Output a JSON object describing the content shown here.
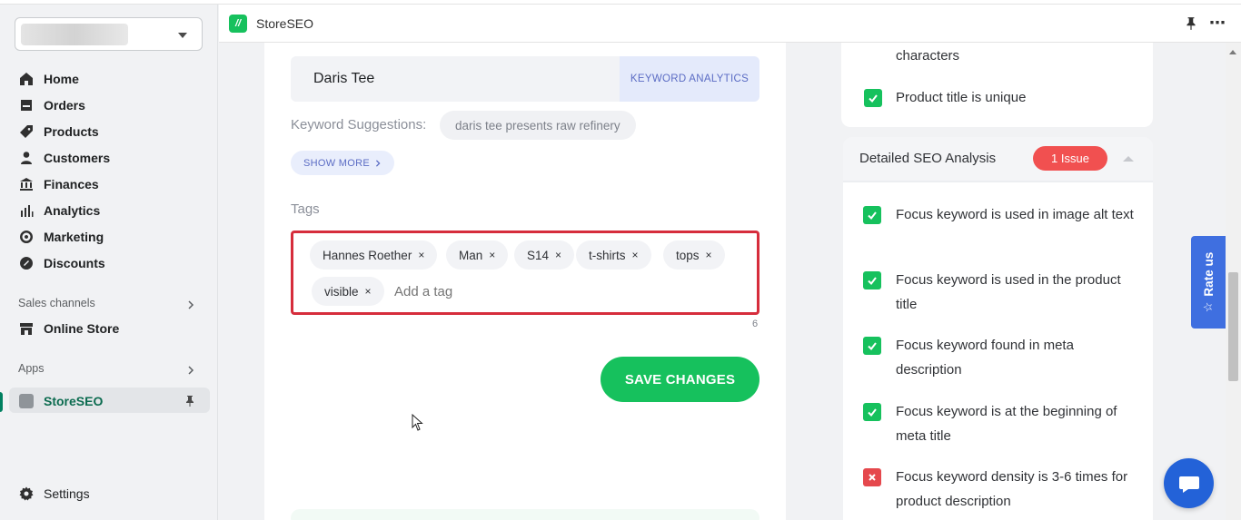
{
  "sidebar": {
    "nav": [
      {
        "label": "Home",
        "icon": "home-icon"
      },
      {
        "label": "Orders",
        "icon": "orders-icon"
      },
      {
        "label": "Products",
        "icon": "tag-icon"
      },
      {
        "label": "Customers",
        "icon": "person-icon"
      },
      {
        "label": "Finances",
        "icon": "bank-icon"
      },
      {
        "label": "Analytics",
        "icon": "bar-chart-icon"
      },
      {
        "label": "Marketing",
        "icon": "target-icon"
      },
      {
        "label": "Discounts",
        "icon": "discount-icon"
      }
    ],
    "sales_channels_label": "Sales channels",
    "online_store_label": "Online Store",
    "apps_label": "Apps",
    "storeseo_label": "StoreSEO",
    "settings_label": "Settings"
  },
  "appbar": {
    "title": "StoreSEO",
    "logo_glyph": "//"
  },
  "editor": {
    "keyword_value": "Daris Tee",
    "keyword_analytics_label": "KEYWORD ANALYTICS",
    "keyword_suggestions_label": "Keyword Suggestions:",
    "suggestion_chip": "daris tee presents raw refinery",
    "show_more_label": "SHOW MORE",
    "tags_label": "Tags",
    "tags": [
      "Hannes Roether",
      "Man",
      "S14",
      "t-shirts",
      "tops",
      "visible"
    ],
    "tag_remove_glyph": "×",
    "tag_placeholder": "Add a tag",
    "tag_count": "6",
    "save_label": "SAVE CHANGES"
  },
  "seo": {
    "top_items": [
      {
        "text": "characters",
        "status": "none"
      },
      {
        "text": "Product title is unique",
        "status": "pass"
      }
    ],
    "detailed_title": "Detailed SEO Analysis",
    "issue_badge": "1 Issue",
    "items": [
      {
        "text": "Focus keyword is used in image alt text",
        "status": "pass"
      },
      {
        "text": "Focus keyword is used in the product title",
        "status": "pass"
      },
      {
        "text": "Focus keyword found in meta description",
        "status": "pass"
      },
      {
        "text": "Focus keyword is at the beginning of meta title",
        "status": "pass"
      },
      {
        "text": "Focus keyword density is 3-6 times for product description",
        "status": "fail"
      }
    ]
  },
  "rate_us_label": "Rate us",
  "colors": {
    "accent_green": "#16c15d",
    "issue_red": "#f15050",
    "highlight_border": "#d62d3c",
    "rate_blue": "#3f6fe0"
  }
}
